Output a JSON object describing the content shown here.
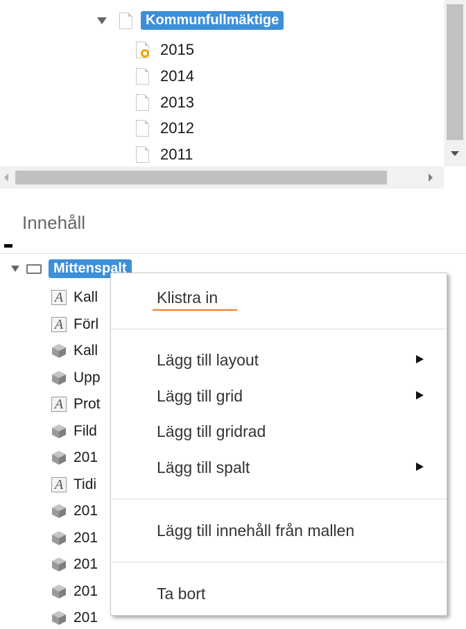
{
  "top_tree": {
    "parent_label": "Kommunfullmäktige",
    "children": [
      {
        "label": "2015",
        "icon": "locked-doc-icon"
      },
      {
        "label": "2014",
        "icon": "doc-icon"
      },
      {
        "label": "2013",
        "icon": "doc-icon"
      },
      {
        "label": "2012",
        "icon": "doc-icon"
      },
      {
        "label": "2011",
        "icon": "doc-icon"
      }
    ]
  },
  "section_title": "Innehåll",
  "content_tree": {
    "root_label": "Mittenspalt",
    "items": [
      {
        "label": "Kall",
        "icon": "text-a-icon"
      },
      {
        "label": "Förl",
        "icon": "text-a-icon"
      },
      {
        "label": "Kall",
        "icon": "cube-icon"
      },
      {
        "label": "Upp",
        "icon": "cube-icon"
      },
      {
        "label": "Prot",
        "icon": "text-a-icon"
      },
      {
        "label": "Fild",
        "icon": "cube-icon"
      },
      {
        "label": "201",
        "icon": "cube-icon"
      },
      {
        "label": "Tidi",
        "icon": "text-a-icon"
      },
      {
        "label": "201",
        "icon": "cube-icon"
      },
      {
        "label": "201",
        "icon": "cube-icon"
      },
      {
        "label": "201",
        "icon": "cube-icon"
      },
      {
        "label": "201",
        "icon": "cube-icon"
      },
      {
        "label": "201",
        "icon": "cube-icon"
      }
    ]
  },
  "context_menu": {
    "paste": "Klistra in",
    "add_layout": "Lägg till layout",
    "add_grid": "Lägg till grid",
    "add_gridrow": "Lägg till gridrad",
    "add_column": "Lägg till spalt",
    "add_from_template": "Lägg till innehåll från mallen",
    "delete": "Ta bort"
  },
  "colors": {
    "selection": "#3d8fd8",
    "accent_underline": "#f07820",
    "lock_badge": "#f5a100"
  }
}
